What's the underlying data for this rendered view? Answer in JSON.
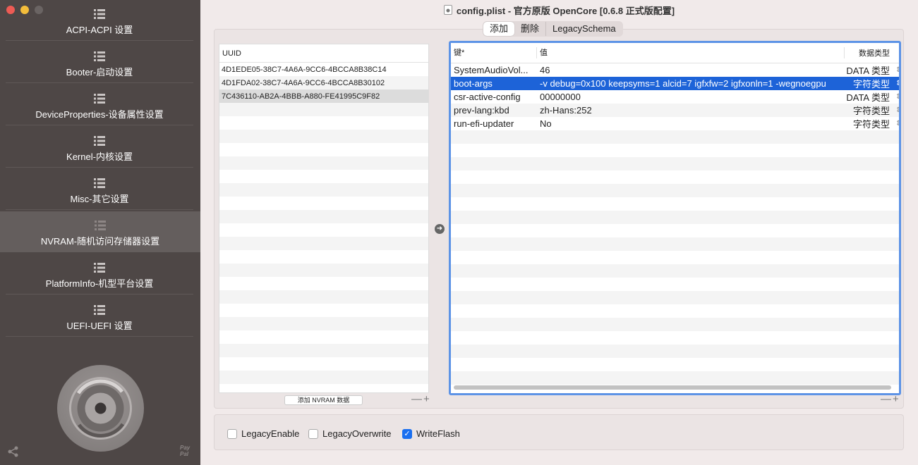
{
  "window": {
    "title": "config.plist - 官方原版 OpenCore [0.6.8 正式版配置]"
  },
  "sidebar": {
    "items": [
      {
        "label": "ACPI-ACPI 设置",
        "active": false
      },
      {
        "label": "Booter-启动设置",
        "active": false
      },
      {
        "label": "DeviceProperties-设备属性设置",
        "active": false
      },
      {
        "label": "Kernel-内核设置",
        "active": false
      },
      {
        "label": "Misc-其它设置",
        "active": false
      },
      {
        "label": "NVRAM-随机访问存储器设置",
        "active": true
      },
      {
        "label": "PlatformInfo-机型平台设置",
        "active": false
      },
      {
        "label": "UEFI-UEFI 设置",
        "active": false
      }
    ],
    "paypal": "PayPal"
  },
  "tabs": [
    "添加",
    "删除",
    "LegacySchema"
  ],
  "uuid_table": {
    "header": "UUID",
    "rows": [
      "4D1EDE05-38C7-4A6A-9CC6-4BCCA8B38C14",
      "4D1FDA02-38C7-4A6A-9CC6-4BCCA8B30102",
      "7C436110-AB2A-4BBB-A880-FE41995C9F82"
    ],
    "add_button": "添加 NVRAM 数据",
    "plus_minus": "—+"
  },
  "kv_table": {
    "headers": {
      "key": "键*",
      "value": "值",
      "type": "数据类型"
    },
    "rows": [
      {
        "key": "SystemAudioVol...",
        "value": "46",
        "type": "DATA 类型"
      },
      {
        "key": "boot-args",
        "value": "-v debug=0x100 keepsyms=1 alcid=7 igfxfw=2 igfxonln=1 -wegnoegpu",
        "type": "字符类型"
      },
      {
        "key": "csr-active-config",
        "value": "00000000",
        "type": "DATA 类型"
      },
      {
        "key": "prev-lang:kbd",
        "value": "zh-Hans:252",
        "type": "字符类型"
      },
      {
        "key": "run-efi-updater",
        "value": "No",
        "type": "字符类型"
      }
    ],
    "plus_minus": "—+"
  },
  "bottom": {
    "legacy_enable": {
      "label": "LegacyEnable",
      "checked": false
    },
    "legacy_overwrite": {
      "label": "LegacyOverwrite",
      "checked": false
    },
    "write_flash": {
      "label": "WriteFlash",
      "checked": true
    }
  }
}
